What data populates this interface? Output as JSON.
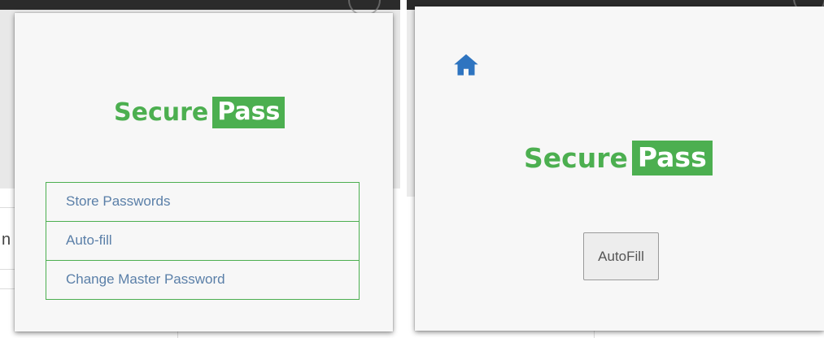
{
  "left_popup": {
    "logo": {
      "word": "Secure",
      "box": "Pass"
    },
    "menu": [
      {
        "label": "Store Passwords"
      },
      {
        "label": "Auto-fill"
      },
      {
        "label": "Change Master Password"
      }
    ]
  },
  "right_popup": {
    "home_icon": "home-icon",
    "logo": {
      "word": "Secure",
      "box": "Pass"
    },
    "autofill_button": "AutoFill"
  },
  "background": {
    "partial_text": "n"
  },
  "colors": {
    "brand_green": "#4caf50",
    "menu_text": "#5a7fa8",
    "home_icon": "#2e74c0",
    "panel": "#f7f7f7"
  }
}
